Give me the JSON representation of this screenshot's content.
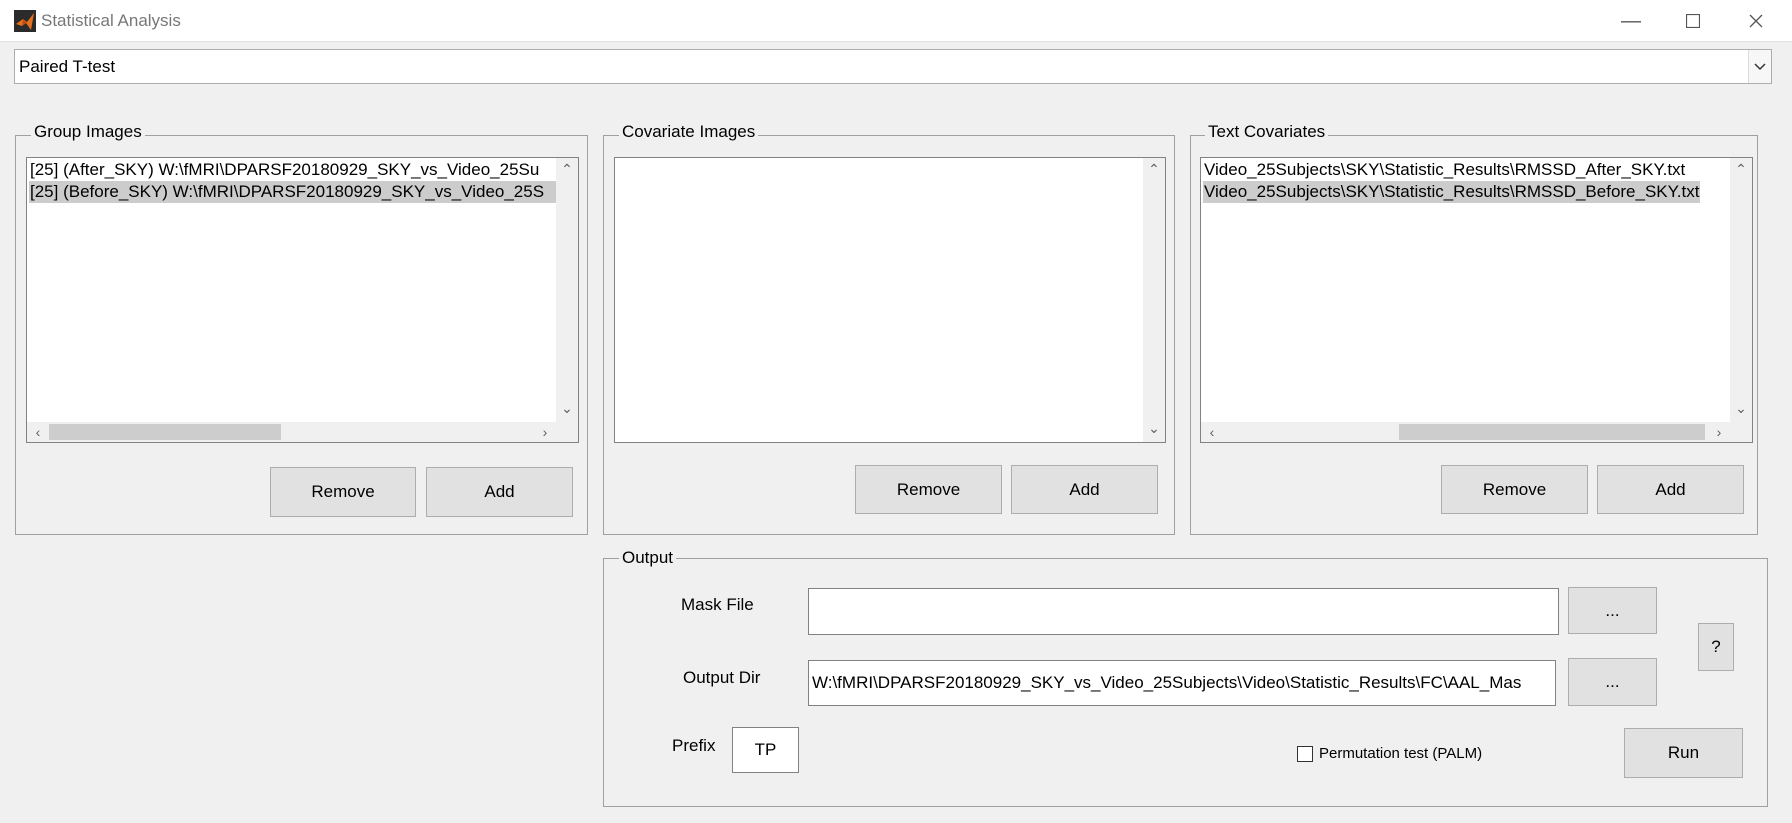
{
  "window": {
    "title": "Statistical Analysis",
    "minimize_icon": "minimize-icon",
    "maximize_icon": "maximize-icon",
    "close_icon": "close-icon"
  },
  "test_select": {
    "value": "Paired T-test"
  },
  "group_images": {
    "legend": "Group Images",
    "items": [
      "[25] (After_SKY) W:\\fMRI\\DPARSF20180929_SKY_vs_Video_25Su",
      "[25] (Before_SKY) W:\\fMRI\\DPARSF20180929_SKY_vs_Video_25S"
    ],
    "remove_label": "Remove",
    "add_label": "Add"
  },
  "covariate_images": {
    "legend": "Covariate Images",
    "remove_label": "Remove",
    "add_label": "Add"
  },
  "text_covariates": {
    "legend": "Text Covariates",
    "items": [
      "Video_25Subjects\\SKY\\Statistic_Results\\RMSSD_After_SKY.txt",
      "Video_25Subjects\\SKY\\Statistic_Results\\RMSSD_Before_SKY.txt"
    ],
    "remove_label": "Remove",
    "add_label": "Add"
  },
  "output": {
    "legend": "Output",
    "mask_label": "Mask File",
    "mask_value": "",
    "mask_browse": "...",
    "dir_label": "Output Dir",
    "dir_value": "W:\\fMRI\\DPARSF20180929_SKY_vs_Video_25Subjects\\Video\\Statistic_Results\\FC\\AAL_Mas",
    "dir_browse": "...",
    "help_label": "?",
    "prefix_label": "Prefix",
    "prefix_value": "TP",
    "permutation_label": "Permutation test (PALM)",
    "permutation_checked": false,
    "run_label": "Run"
  }
}
